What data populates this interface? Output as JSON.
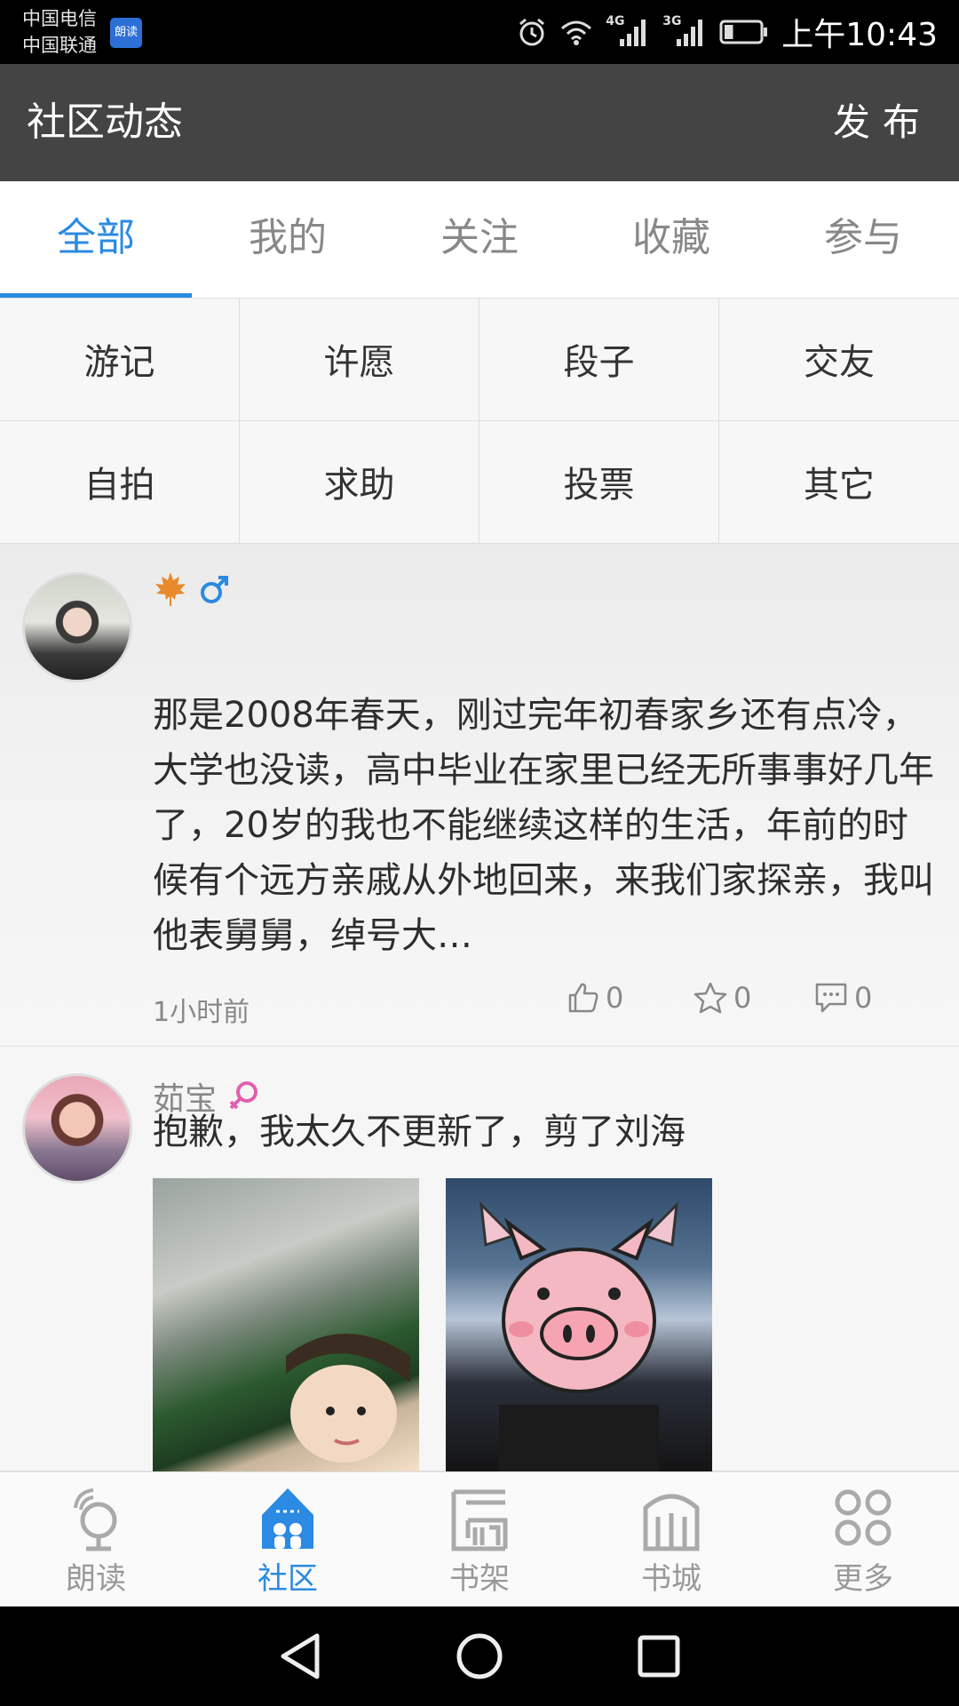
{
  "status_bar": {
    "carrier_1": "中国电信",
    "carrier_2": "中国联通",
    "app_badge": "朗读",
    "network_1": "4G",
    "network_2": "3G",
    "time": "上午10:43",
    "battery_level": 0.25
  },
  "header": {
    "title": "社区动态",
    "publish_label": "发布"
  },
  "tabs": [
    {
      "label": "全部",
      "active": true
    },
    {
      "label": "我的",
      "active": false
    },
    {
      "label": "关注",
      "active": false
    },
    {
      "label": "收藏",
      "active": false
    },
    {
      "label": "参与",
      "active": false
    }
  ],
  "categories": [
    "游记",
    "许愿",
    "段子",
    "交友",
    "自拍",
    "求助",
    "投票",
    "其它"
  ],
  "posts": [
    {
      "username": "",
      "badge_icon": "maple-leaf-icon",
      "gender": "male",
      "gender_color": "#2b8ae2",
      "text": "那是2008年春天，刚过完年初春家乡还有点冷，大学也没读，高中毕业在家里已经无所事事好几年了，20岁的我也不能继续这样的生活，年前的时候有个远方亲戚从外地回来，来我们家探亲，我叫他表舅舅，绰号大…",
      "time": "1小时前",
      "likes": "0",
      "stars": "0",
      "comments": "0"
    },
    {
      "username": "茹宝",
      "gender": "female",
      "gender_color": "#e060b0",
      "text": "抱歉，我太久不更新了，剪了刘海",
      "photo_count": 2
    }
  ],
  "bottom_nav": [
    {
      "label": "朗读",
      "icon": "microphone-icon",
      "active": false
    },
    {
      "label": "社区",
      "icon": "community-house-icon",
      "active": true
    },
    {
      "label": "书架",
      "icon": "bookshelf-icon",
      "active": false
    },
    {
      "label": "书城",
      "icon": "bookstore-icon",
      "active": false
    },
    {
      "label": "更多",
      "icon": "more-grid-icon",
      "active": false
    }
  ],
  "colors": {
    "accent": "#2b8ae2",
    "header_bg": "#444444",
    "female": "#e060b0",
    "maple": "#e8892b"
  }
}
